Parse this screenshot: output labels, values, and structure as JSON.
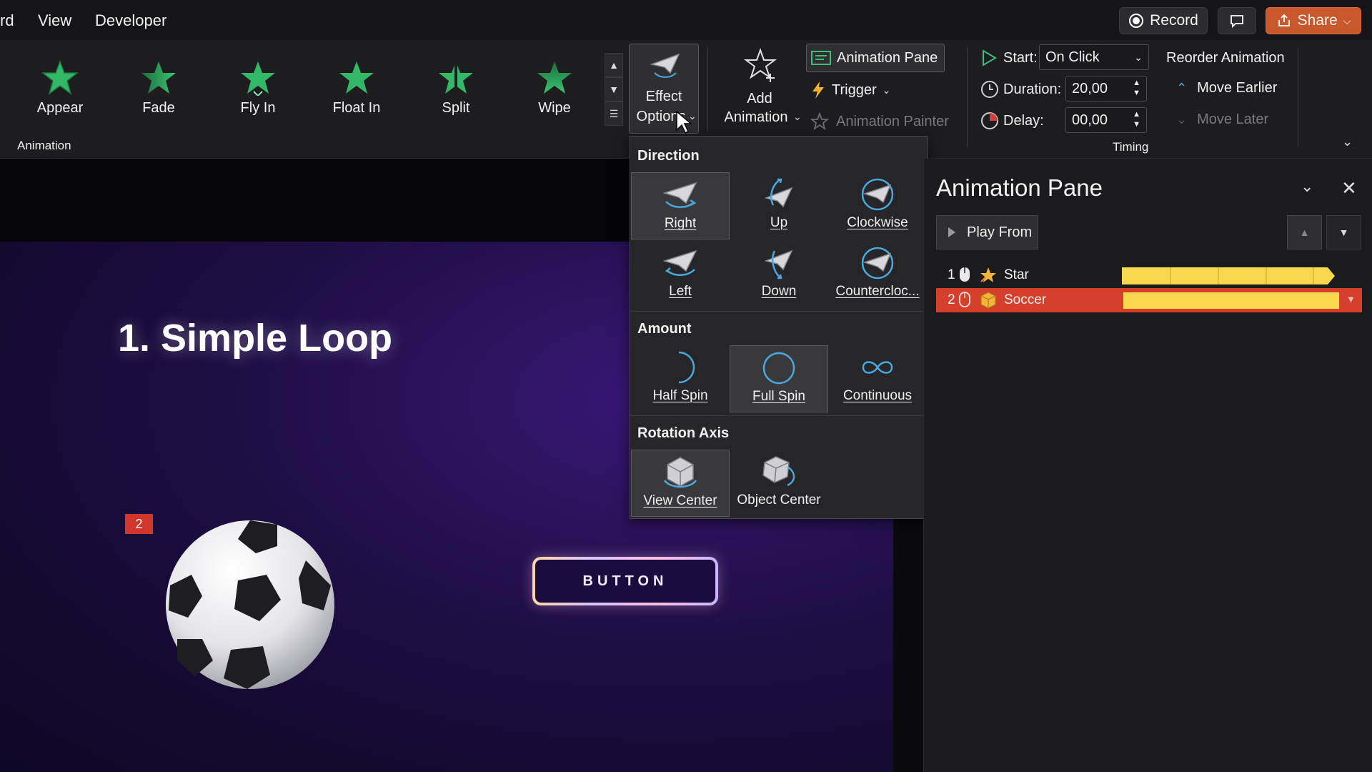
{
  "menu": {
    "items": [
      "rd",
      "View",
      "Developer"
    ]
  },
  "top_buttons": {
    "record": "Record",
    "share": "Share"
  },
  "ribbon": {
    "gallery": [
      "Appear",
      "Fade",
      "Fly In",
      "Float In",
      "Split",
      "Wipe"
    ],
    "group_animation_label": "Animation",
    "effect_options": {
      "line1": "Effect",
      "line2": "Options"
    },
    "add_animation": {
      "line1": "Add",
      "line2": "Animation"
    },
    "animation_pane_btn": "Animation Pane",
    "trigger": "Trigger",
    "animation_painter": "Animation Painter",
    "timing": {
      "start_label": "Start:",
      "start_value": "On Click",
      "duration_label": "Duration:",
      "duration_value": "20,00",
      "delay_label": "Delay:",
      "delay_value": "00,00",
      "group_label": "Timing"
    },
    "reorder": {
      "title": "Reorder Animation",
      "earlier": "Move Earlier",
      "later": "Move Later"
    }
  },
  "dropdown": {
    "direction_header": "Direction",
    "direction": [
      "Right",
      "Up",
      "Clockwise",
      "Left",
      "Down",
      "Countercloc..."
    ],
    "amount_header": "Amount",
    "amount": [
      "Half Spin",
      "Full Spin",
      "Continuous"
    ],
    "axis_header": "Rotation Axis",
    "axis": [
      "View Center",
      "Object Center"
    ]
  },
  "slide": {
    "title": "1. Simple Loop",
    "badge": "2",
    "button": "BUTTON"
  },
  "pane": {
    "title": "Animation Pane",
    "play_from": "Play From",
    "rows": [
      {
        "num": "1",
        "name": "Star"
      },
      {
        "num": "2",
        "name": "Soccer"
      }
    ]
  },
  "colors": {
    "accent_orange": "#c9592c",
    "selected_row": "#d4402c",
    "timeline_bar": "#f7d84f",
    "star_green": "#2faa5c"
  }
}
